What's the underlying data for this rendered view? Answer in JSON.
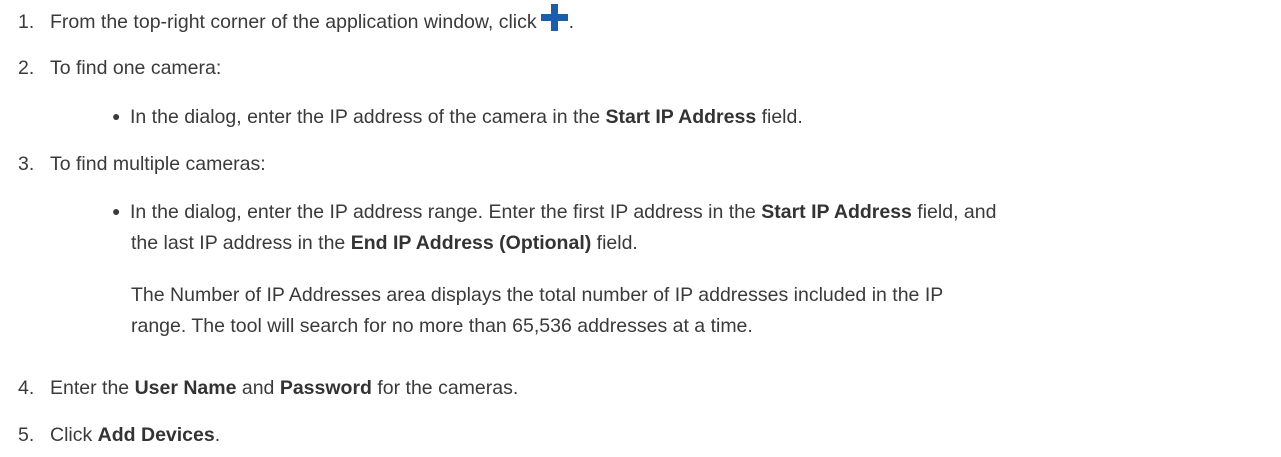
{
  "steps": [
    {
      "number": "1.",
      "text_before": "From the top-right corner of the application window, click",
      "icon": "plus-icon",
      "icon_color": "#1a5fa8",
      "text_after": "."
    },
    {
      "number": "2.",
      "text": "To find one camera:",
      "bullet": {
        "t1": "In the dialog, enter the IP address of the camera in the ",
        "b1": "Start IP Address",
        "t2": " field."
      }
    },
    {
      "number": "3.",
      "text": "To find multiple cameras:",
      "bullet": {
        "t1": "In the dialog, enter the IP address range. Enter the first IP address in the ",
        "b1": "Start IP Address",
        "t2": " field, and",
        "line2_t1": "the last IP address in the ",
        "line2_b1": "End IP Address (Optional)",
        "line2_t2": " field."
      },
      "note_line1": "The Number of IP Addresses area displays the total number of IP addresses included in the IP",
      "note_line2": "range. The tool will search for no more than 65,536 addresses at a time."
    },
    {
      "number": "4.",
      "t1": "Enter the ",
      "b1": "User Name",
      "t2": " and ",
      "b2": "Password",
      "t3": " for the cameras."
    },
    {
      "number": "5.",
      "t1": "Click ",
      "b1": "Add Devices",
      "t2": "."
    }
  ]
}
